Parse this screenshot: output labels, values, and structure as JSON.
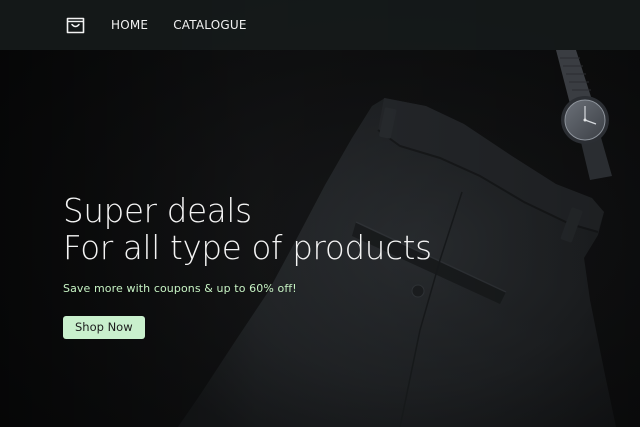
{
  "nav": {
    "logo_icon": "shopping-bag-icon",
    "links": [
      {
        "label": "HOME"
      },
      {
        "label": "CATALOGUE"
      }
    ]
  },
  "hero": {
    "headline_line1": "Super deals",
    "headline_line2": "For all type of products",
    "subtext": "Save more with coupons & up to 60% off!",
    "cta_label": "Shop Now"
  },
  "colors": {
    "accent": "#c9f0cd",
    "subtext": "#c6f2c3",
    "navbar": "#161a1a",
    "background": "#0d0e0f"
  }
}
